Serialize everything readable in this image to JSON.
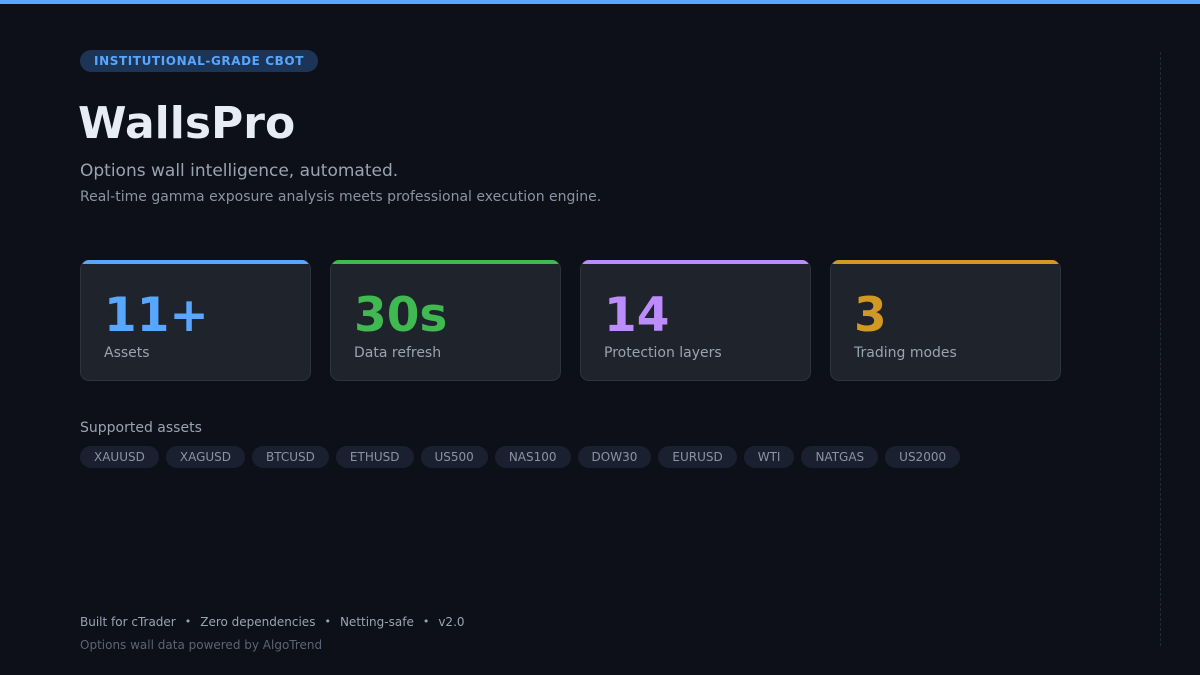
{
  "header": {
    "badge": "INSTITUTIONAL-GRADE CBOT",
    "title": "WallsPro",
    "tagline": "Options wall intelligence, automated.",
    "description": "Real-time gamma exposure analysis meets professional execution engine."
  },
  "colors": {
    "accent_blue": "#58a6ff",
    "accent_green": "#3fb950",
    "accent_purple": "#bc8cff",
    "accent_gold": "#d29922",
    "background": "#0d1018"
  },
  "stats": [
    {
      "value": "11+",
      "label": "Assets",
      "color": "#58a6ff"
    },
    {
      "value": "30s",
      "label": "Data refresh",
      "color": "#3fb950"
    },
    {
      "value": "14",
      "label": "Protection layers",
      "color": "#bc8cff"
    },
    {
      "value": "3",
      "label": "Trading modes",
      "color": "#d29922"
    }
  ],
  "assets": {
    "heading": "Supported assets",
    "items": [
      "XAUUSD",
      "XAGUSD",
      "BTCUSD",
      "ETHUSD",
      "US500",
      "NAS100",
      "DOW30",
      "EURUSD",
      "WTI",
      "NATGAS",
      "US2000"
    ]
  },
  "footer": {
    "items": [
      "Built for cTrader",
      "Zero dependencies",
      "Netting-safe",
      "v2.0"
    ],
    "separator": "•",
    "credit": "Options wall data powered by AlgoTrend"
  }
}
